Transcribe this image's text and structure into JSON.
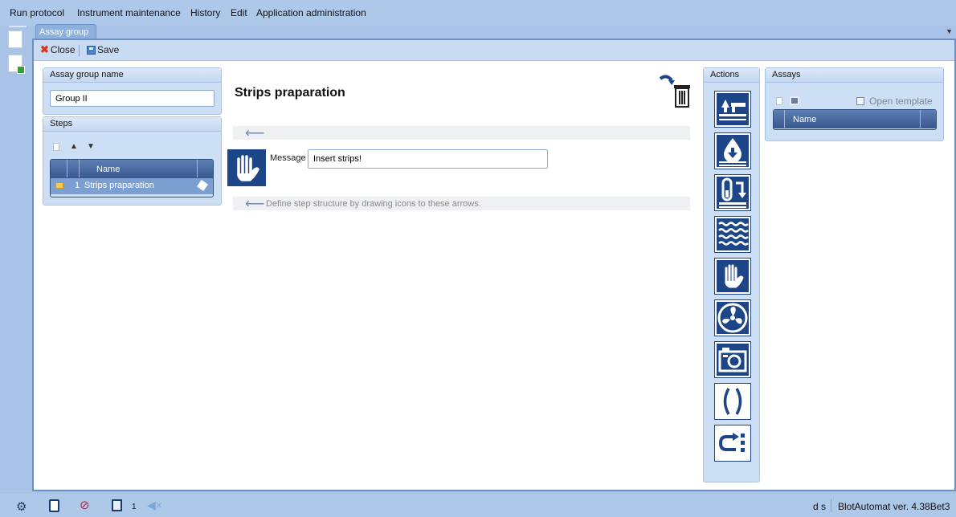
{
  "menu": [
    "Run protocol",
    "Instrument maintenance",
    "History",
    "Edit",
    "Application administration"
  ],
  "tab": {
    "label": "Assay group"
  },
  "toolbar": {
    "close_label": "Close",
    "save_label": "Save"
  },
  "assay_group": {
    "header": "Assay group name",
    "name_value": "Group II"
  },
  "steps": {
    "header": "Steps",
    "column_name": "Name",
    "rows": [
      {
        "number": "1",
        "name": "Strips praparation"
      }
    ]
  },
  "editor": {
    "title": "Strips praparation",
    "message_label": "Message",
    "message_value": "Insert strips!",
    "hint": "Define step structure by drawing icons to these arrows."
  },
  "actions": {
    "header": "Actions",
    "items": [
      "aspirate-icon",
      "dispense-drop-icon",
      "tube-transfer-icon",
      "wave-incubation-icon",
      "hand-message-icon",
      "fan-drying-icon",
      "camera-icon",
      "parenthesis-group-icon",
      "loop-repeat-icon"
    ]
  },
  "assays": {
    "header": "Assays",
    "open_template_label": "Open template",
    "column_name": "Name"
  },
  "status": {
    "notify_count": "1",
    "user": "d s",
    "version": "BlotAutomat ver. 4.38Bet3"
  },
  "colors": {
    "accent": "#1c4688",
    "panel": "#cddff4",
    "menubar": "#aec8ea"
  }
}
